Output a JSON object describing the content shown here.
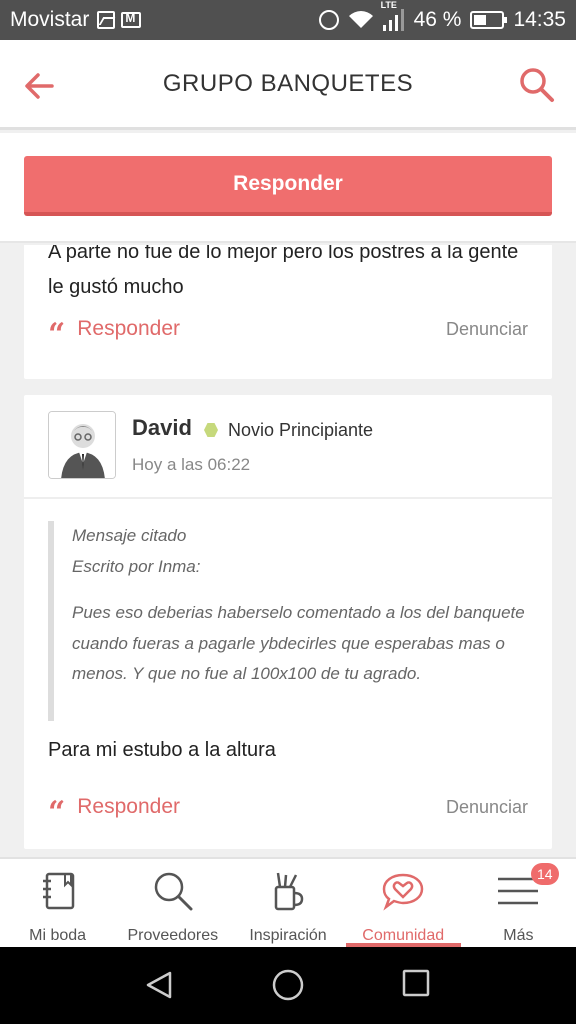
{
  "status_bar": {
    "carrier": "Movistar",
    "network": "LTE",
    "battery": "46 %",
    "time": "14:35",
    "battery_level": 0.46
  },
  "header": {
    "title": "GRUPO BANQUETES",
    "back_icon": "arrow-left-icon",
    "search_icon": "search-icon"
  },
  "reply_button": {
    "label": "Responder"
  },
  "posts": [
    {
      "text": "A parte no fue de lo mejor pero los postres a la gente le gustó mucho",
      "respond_label": "Responder",
      "report_label": "Denunciar"
    },
    {
      "author": "David",
      "rank": "Novio Principiante",
      "time": "Hoy a las 06:22",
      "quote_title": "Mensaje citado",
      "quote_author": "Escrito por Inma:",
      "quote_text": "Pues eso deberias haberselo comentado a los del banquete cuando fueras a pagarle ybdecirles que esperabas mas o menos. Y que no fue al 100x100 de tu agrado.",
      "text": "Para mi estubo a la altura",
      "respond_label": "Responder",
      "report_label": "Denunciar"
    }
  ],
  "bottom_nav": {
    "items": [
      {
        "label": "Mi boda",
        "icon": "notebook-icon"
      },
      {
        "label": "Proveedores",
        "icon": "search-icon"
      },
      {
        "label": "Inspiración",
        "icon": "pencil-cup-icon"
      },
      {
        "label": "Comunidad",
        "icon": "heart-chat-icon",
        "active": true
      },
      {
        "label": "Más",
        "icon": "menu-icon",
        "badge": "14"
      }
    ]
  },
  "colors": {
    "accent": "#f06e6e",
    "text": "#222222",
    "muted": "#888888",
    "badge_green": "#c6d97c"
  }
}
